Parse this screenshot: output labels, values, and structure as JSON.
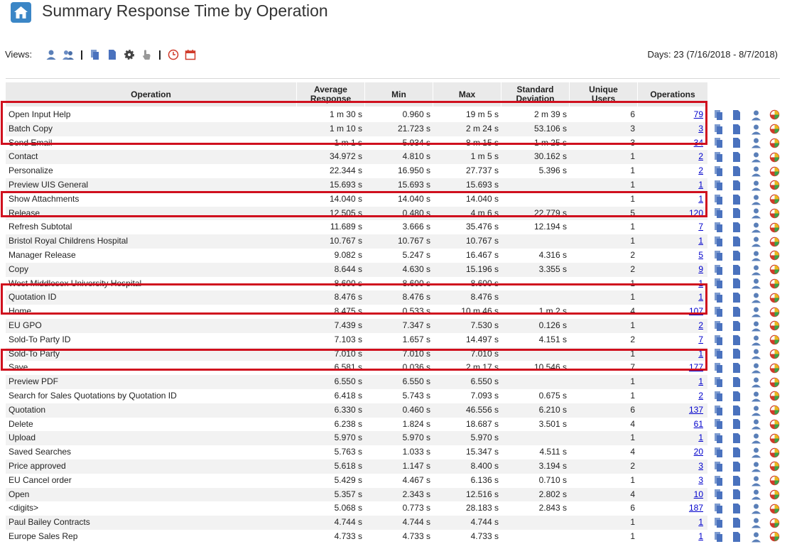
{
  "page": {
    "title": "Summary Response Time by Operation",
    "views_label": "Views:",
    "days": "Days: 23 (7/16/2018 - 8/7/2018)"
  },
  "view_icons": [
    "user-icon",
    "users-icon",
    "copy-pages-icon",
    "document-icon",
    "gear-icon",
    "hand-pointer-icon",
    "clock-icon",
    "calendar-icon"
  ],
  "action_icons": [
    "copy-pages-icon",
    "document-icon",
    "user-icon",
    "pie-chart-icon"
  ],
  "colors": {
    "highlight": "#d0101e",
    "link": "#0000cc",
    "icon_blue": "#5b80c2",
    "header_bg": "#eaeaea"
  },
  "table": {
    "headers": {
      "operation": "Operation",
      "avg_line1": "Average",
      "avg_line2": "Response",
      "min": "Min",
      "max": "Max",
      "std_line1": "Standard",
      "std_line2": "Deviation",
      "users_line1": "Unique",
      "users_line2": "Users",
      "ops": "Operations"
    },
    "rows": [
      {
        "op": "Open Input Help",
        "avg": "1 m 30 s",
        "min": "0.960 s",
        "max": "19 m 5 s",
        "std": "2 m 39 s",
        "users": "6",
        "ops": "79"
      },
      {
        "op": "Batch Copy",
        "avg": "1 m 10 s",
        "min": "21.723 s",
        "max": "2 m 24 s",
        "std": "53.106 s",
        "users": "3",
        "ops": "3"
      },
      {
        "op": "Send Email",
        "avg": "1 m 1 s",
        "min": "5.934 s",
        "max": "8 m 15 s",
        "std": "1 m 25 s",
        "users": "3",
        "ops": "34"
      },
      {
        "op": "Contact",
        "avg": "34.972 s",
        "min": "4.810 s",
        "max": "1 m 5 s",
        "std": "30.162 s",
        "users": "1",
        "ops": "2"
      },
      {
        "op": "Personalize",
        "avg": "22.344 s",
        "min": "16.950 s",
        "max": "27.737 s",
        "std": "5.396 s",
        "users": "1",
        "ops": "2"
      },
      {
        "op": "Preview UIS General",
        "avg": "15.693 s",
        "min": "15.693 s",
        "max": "15.693 s",
        "std": "",
        "users": "1",
        "ops": "1"
      },
      {
        "op": "Show Attachments",
        "avg": "14.040 s",
        "min": "14.040 s",
        "max": "14.040 s",
        "std": "",
        "users": "1",
        "ops": "1"
      },
      {
        "op": "Release",
        "avg": "12.505 s",
        "min": "0.480 s",
        "max": "4 m 6 s",
        "std": "22.779 s",
        "users": "5",
        "ops": "120"
      },
      {
        "op": "Refresh Subtotal",
        "avg": "11.689 s",
        "min": "3.666 s",
        "max": "35.476 s",
        "std": "12.194 s",
        "users": "1",
        "ops": "7"
      },
      {
        "op": "Bristol Royal Childrens Hospital",
        "avg": "10.767 s",
        "min": "10.767 s",
        "max": "10.767 s",
        "std": "",
        "users": "1",
        "ops": "1"
      },
      {
        "op": "Manager Release",
        "avg": "9.082 s",
        "min": "5.247 s",
        "max": "16.467 s",
        "std": "4.316 s",
        "users": "2",
        "ops": "5"
      },
      {
        "op": "Copy",
        "avg": "8.644 s",
        "min": "4.630 s",
        "max": "15.196 s",
        "std": "3.355 s",
        "users": "2",
        "ops": "9"
      },
      {
        "op": "West Middlesex University Hospital",
        "avg": "8.600 s",
        "min": "8.600 s",
        "max": "8.600 s",
        "std": "",
        "users": "1",
        "ops": "1"
      },
      {
        "op": "Quotation ID",
        "avg": "8.476 s",
        "min": "8.476 s",
        "max": "8.476 s",
        "std": "",
        "users": "1",
        "ops": "1"
      },
      {
        "op": "Home",
        "avg": "8.475 s",
        "min": "0.533 s",
        "max": "10 m 46 s",
        "std": "1 m 2 s",
        "users": "4",
        "ops": "107"
      },
      {
        "op": "EU GPO",
        "avg": "7.439 s",
        "min": "7.347 s",
        "max": "7.530 s",
        "std": "0.126 s",
        "users": "1",
        "ops": "2"
      },
      {
        "op": "Sold-To Party ID",
        "avg": "7.103 s",
        "min": "1.657 s",
        "max": "14.497 s",
        "std": "4.151 s",
        "users": "2",
        "ops": "7"
      },
      {
        "op": "Sold-To Party",
        "avg": "7.010 s",
        "min": "7.010 s",
        "max": "7.010 s",
        "std": "",
        "users": "1",
        "ops": "1"
      },
      {
        "op": "Save",
        "avg": "6.581 s",
        "min": "0.036 s",
        "max": "2 m 17 s",
        "std": "10.546 s",
        "users": "7",
        "ops": "177"
      },
      {
        "op": "Preview PDF",
        "avg": "6.550 s",
        "min": "6.550 s",
        "max": "6.550 s",
        "std": "",
        "users": "1",
        "ops": "1"
      },
      {
        "op": "Search for Sales Quotations by Quotation ID",
        "avg": "6.418 s",
        "min": "5.743 s",
        "max": "7.093 s",
        "std": "0.675 s",
        "users": "1",
        "ops": "2"
      },
      {
        "op": "Quotation",
        "avg": "6.330 s",
        "min": "0.460 s",
        "max": "46.556 s",
        "std": "6.210 s",
        "users": "6",
        "ops": "137"
      },
      {
        "op": "Delete",
        "avg": "6.238 s",
        "min": "1.824 s",
        "max": "18.687 s",
        "std": "3.501 s",
        "users": "4",
        "ops": "61"
      },
      {
        "op": "Upload",
        "avg": "5.970 s",
        "min": "5.970 s",
        "max": "5.970 s",
        "std": "",
        "users": "1",
        "ops": "1"
      },
      {
        "op": "Saved Searches",
        "avg": "5.763 s",
        "min": "1.033 s",
        "max": "15.347 s",
        "std": "4.511 s",
        "users": "4",
        "ops": "20"
      },
      {
        "op": "Price approved",
        "avg": "5.618 s",
        "min": "1.147 s",
        "max": "8.400 s",
        "std": "3.194 s",
        "users": "2",
        "ops": "3"
      },
      {
        "op": "EU Cancel order",
        "avg": "5.429 s",
        "min": "4.467 s",
        "max": "6.136 s",
        "std": "0.710 s",
        "users": "1",
        "ops": "3"
      },
      {
        "op": "Open",
        "avg": "5.357 s",
        "min": "2.343 s",
        "max": "12.516 s",
        "std": "2.802 s",
        "users": "4",
        "ops": "10"
      },
      {
        "op": "<digits>",
        "avg": "5.068 s",
        "min": "0.773 s",
        "max": "28.183 s",
        "std": "2.843 s",
        "users": "6",
        "ops": "187"
      },
      {
        "op": "Paul Bailey Contracts",
        "avg": "4.744 s",
        "min": "4.744 s",
        "max": "4.744 s",
        "std": "",
        "users": "1",
        "ops": "1"
      },
      {
        "op": "Europe Sales Rep",
        "avg": "4.733 s",
        "min": "4.733 s",
        "max": "4.733 s",
        "std": "",
        "users": "1",
        "ops": "1"
      }
    ]
  }
}
